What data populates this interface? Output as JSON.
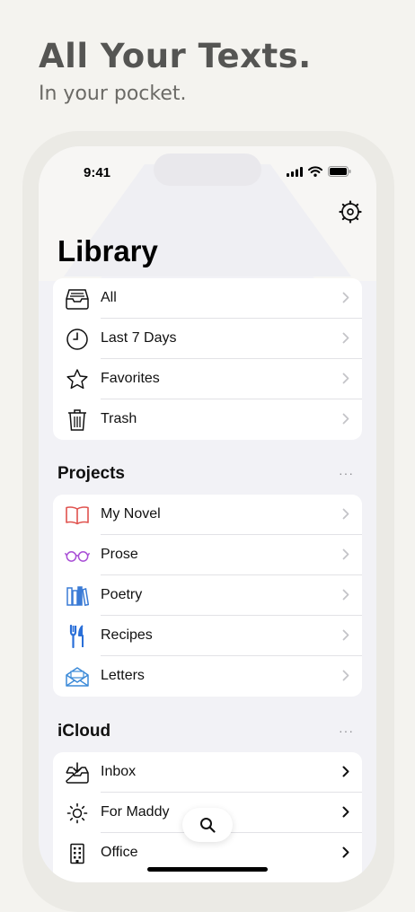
{
  "hero": {
    "headline": "All Your Texts.",
    "subline": "In your pocket."
  },
  "status_bar": {
    "time": "9:41"
  },
  "library": {
    "title": "Library",
    "items": [
      {
        "label": "All",
        "icon": "tray-icon"
      },
      {
        "label": "Last 7 Days",
        "icon": "clock-icon"
      },
      {
        "label": "Favorites",
        "icon": "star-icon"
      },
      {
        "label": "Trash",
        "icon": "trash-icon"
      }
    ]
  },
  "projects": {
    "title": "Projects",
    "more": "···",
    "items": [
      {
        "label": "My Novel",
        "icon": "book-icon",
        "color": "#e0524e"
      },
      {
        "label": "Prose",
        "icon": "glasses-icon",
        "color": "#a94fd6"
      },
      {
        "label": "Poetry",
        "icon": "books-icon",
        "color": "#3a7bd5"
      },
      {
        "label": "Recipes",
        "icon": "fork-knife-icon",
        "color": "#2a6fd8"
      },
      {
        "label": "Letters",
        "icon": "envelope-icon",
        "color": "#3b8ad8"
      }
    ]
  },
  "icloud": {
    "title": "iCloud",
    "more": "···",
    "items": [
      {
        "label": "Inbox",
        "icon": "inbox-icon"
      },
      {
        "label": "For Maddy",
        "icon": "sun-icon"
      },
      {
        "label": "Office",
        "icon": "building-icon"
      }
    ]
  }
}
